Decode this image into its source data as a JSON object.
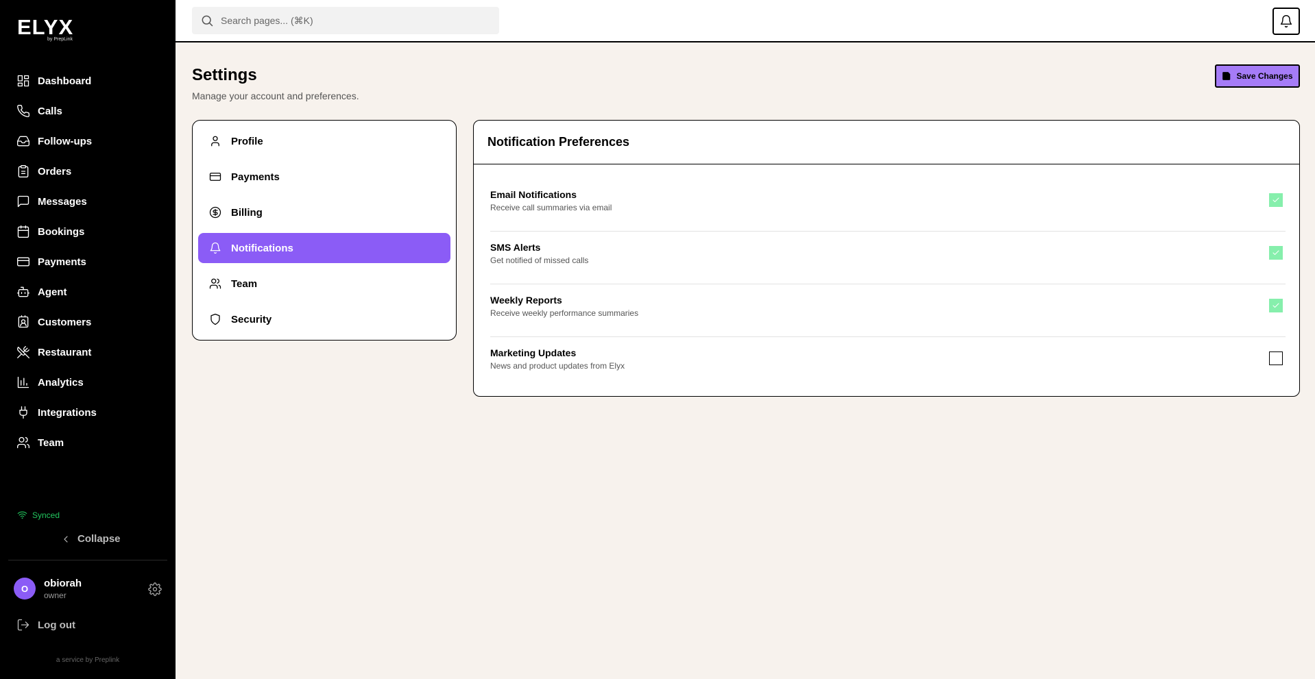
{
  "brand": {
    "name": "ELYX",
    "sub": "by PrepLink"
  },
  "nav": [
    {
      "label": "Dashboard",
      "icon": "dashboard-icon"
    },
    {
      "label": "Calls",
      "icon": "phone-icon"
    },
    {
      "label": "Follow-ups",
      "icon": "inbox-icon"
    },
    {
      "label": "Orders",
      "icon": "clipboard-icon"
    },
    {
      "label": "Messages",
      "icon": "message-icon"
    },
    {
      "label": "Bookings",
      "icon": "calendar-icon"
    },
    {
      "label": "Payments",
      "icon": "credit-card-icon"
    },
    {
      "label": "Agent",
      "icon": "bot-icon"
    },
    {
      "label": "Customers",
      "icon": "contact-icon"
    },
    {
      "label": "Restaurant",
      "icon": "utensils-icon"
    },
    {
      "label": "Analytics",
      "icon": "bar-chart-icon"
    },
    {
      "label": "Integrations",
      "icon": "plug-icon"
    },
    {
      "label": "Team",
      "icon": "users-icon"
    }
  ],
  "sidebar_footer": {
    "synced_label": "Synced",
    "collapse_label": "Collapse",
    "user": {
      "initial": "O",
      "name": "obiorah",
      "role": "owner"
    },
    "logout_label": "Log out",
    "service_text": "a service by Preplink"
  },
  "colors": {
    "accent": "#8b5cf6",
    "save_bg": "#a57cf7",
    "synced": "#22c55e",
    "checked": "#86efac",
    "page_bg": "#f7f2ed"
  },
  "search": {
    "placeholder": "Search pages... (⌘K)"
  },
  "page": {
    "title": "Settings",
    "subtitle": "Manage your account and preferences.",
    "save_label": "Save Changes"
  },
  "settings_menu": [
    {
      "label": "Profile",
      "icon": "user-icon",
      "active": false
    },
    {
      "label": "Payments",
      "icon": "credit-card-icon",
      "active": false
    },
    {
      "label": "Billing",
      "icon": "dollar-circle-icon",
      "active": false
    },
    {
      "label": "Notifications",
      "icon": "bell-icon",
      "active": true
    },
    {
      "label": "Team",
      "icon": "users-icon",
      "active": false
    },
    {
      "label": "Security",
      "icon": "shield-icon",
      "active": false
    }
  ],
  "notifications": {
    "title": "Notification Preferences",
    "items": [
      {
        "title": "Email Notifications",
        "desc": "Receive call summaries via email",
        "checked": true
      },
      {
        "title": "SMS Alerts",
        "desc": "Get notified of missed calls",
        "checked": true
      },
      {
        "title": "Weekly Reports",
        "desc": "Receive weekly performance summaries",
        "checked": true
      },
      {
        "title": "Marketing Updates",
        "desc": "News and product updates from Elyx",
        "checked": false
      }
    ]
  }
}
